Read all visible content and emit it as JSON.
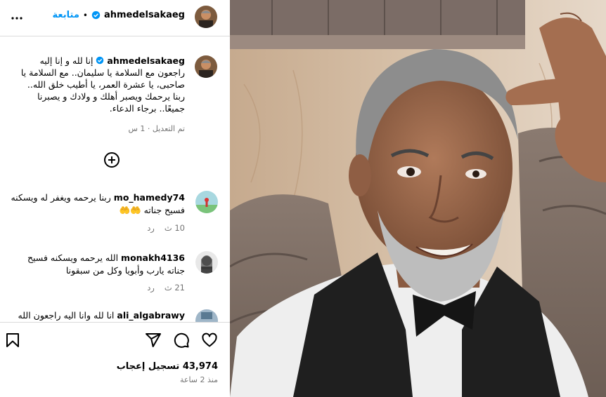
{
  "post": {
    "username": "ahmedelsakaeg",
    "follow_label": "متابعة",
    "dot": "•"
  },
  "caption": {
    "username": "ahmedelsakaeg",
    "text_line1": "إنا لله و إنا إليه راجعون",
    "text_rest": "مع السلامة يا سليمان.. مع السلامة يا صاحبى، يا عشرة العمر، يا أطيب خلق الله.. ربنا يرحمك ويصبر أهلك و ولادك و يصبرنا جميعًا.. برجاء الدعاء.",
    "edited": "تم التعديل · 1 س"
  },
  "comments": [
    {
      "username": "mo_hamedy74",
      "text": "ربنا يرحمه ويغفر له ويسكنه فسيح جناته 🤲🤲",
      "likes": "10 ث",
      "reply": "رد"
    },
    {
      "username": "monakh4136",
      "text": "الله يرحمه ويسكنه فسيح جناته يارب وأبويا وكل من سبقونا",
      "likes": "21 ث",
      "reply": "رد"
    },
    {
      "username": "ali_algabrawy",
      "text": "انا لله وانا اليه راجعون الله",
      "likes": "",
      "reply": ""
    }
  ],
  "footer": {
    "likes": "43,974 تسجيل إعجاب",
    "time": "منذ 2 ساعة"
  },
  "icons": [
    "more-icon",
    "verified-icon",
    "add-comment-icon",
    "heart-icon",
    "comment-icon",
    "share-icon",
    "save-icon"
  ],
  "colors": {
    "follow": "#0095f6",
    "verified": "#0095f6",
    "meta": "#737373"
  }
}
